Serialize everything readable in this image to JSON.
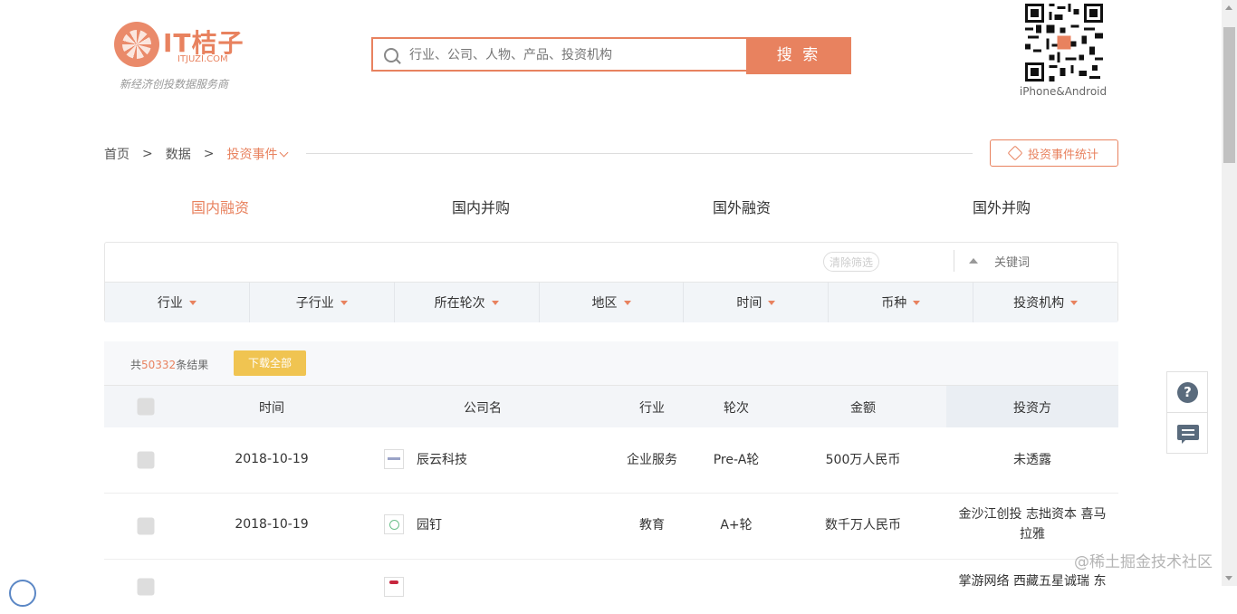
{
  "header": {
    "logo_text": "IT桔子",
    "logo_sub": "ITJUZI.COM",
    "logo_slogan": "新经济创投数据服务商",
    "search_placeholder": "行业、公司、人物、产品、投资机构",
    "search_button": "搜 索",
    "qr_caption": "iPhone&Android"
  },
  "breadcrumb": {
    "items": [
      "首页",
      ">",
      "数据",
      ">"
    ],
    "current": "投资事件"
  },
  "stat_button": "投资事件统计",
  "tabs": [
    {
      "label": "国内融资",
      "active": true
    },
    {
      "label": "国内并购",
      "active": false
    },
    {
      "label": "国外融资",
      "active": false
    },
    {
      "label": "国外并购",
      "active": false
    }
  ],
  "filter": {
    "clear_label": "清除筛选",
    "keyword_placeholder": "关键词",
    "dropdowns": [
      "行业",
      "子行业",
      "所在轮次",
      "地区",
      "时间",
      "币种",
      "投资机构"
    ]
  },
  "results": {
    "prefix": "共",
    "count": "50332",
    "suffix": "条结果",
    "download_label": "下载全部"
  },
  "table": {
    "headers": {
      "time": "时间",
      "company": "公司名",
      "industry": "行业",
      "round": "轮次",
      "amount": "金额",
      "investors": "投资方"
    },
    "rows": [
      {
        "time": "2018-10-19",
        "company": "辰云科技",
        "industry": "企业服务",
        "round": "Pre-A轮",
        "amount": "500万人民币",
        "investors": "未透露"
      },
      {
        "time": "2018-10-19",
        "company": "园钉",
        "industry": "教育",
        "round": "A+轮",
        "amount": "数千万人民币",
        "investors": "金沙江创投 志拙资本 喜马拉雅"
      },
      {
        "time": "",
        "company": "",
        "industry": "",
        "round": "",
        "amount": "",
        "investors": "掌游网络 西藏五星诚瑞 东"
      }
    ]
  },
  "side": {
    "help_glyph": "?"
  },
  "watermark": "@稀土掘金技术社区",
  "colors": {
    "accent": "#e8825f",
    "download": "#f0c451",
    "header_bg": "#f3f5f8"
  },
  "icons": [
    "search-icon",
    "tag-icon",
    "chevron-down-icon",
    "caret-down-icon",
    "help-icon",
    "chat-icon",
    "qr-code"
  ]
}
